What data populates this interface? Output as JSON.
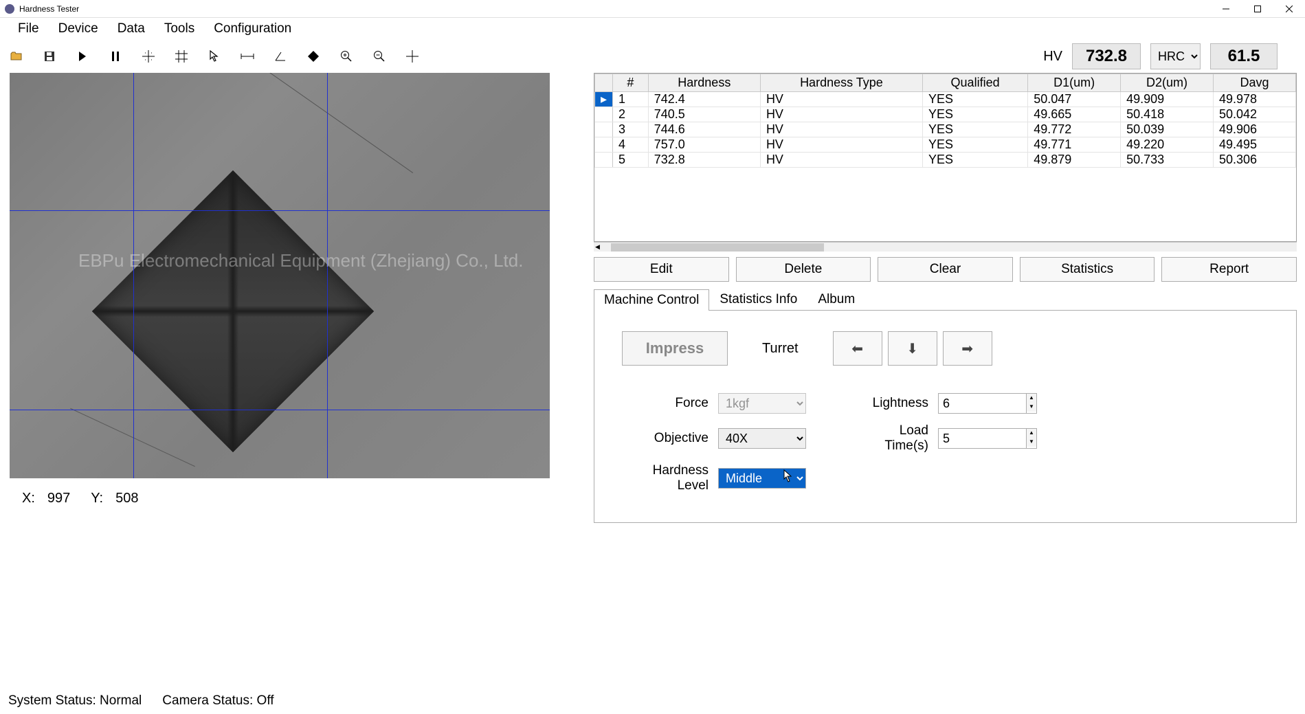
{
  "title": "Hardness Tester",
  "menu": [
    "File",
    "Device",
    "Data",
    "Tools",
    "Configuration"
  ],
  "readout": {
    "hv_label": "HV",
    "hv_value": "732.8",
    "scale_selected": "HRC",
    "scale_value": "61.5"
  },
  "watermark": "EBPu Electromechanical Equipment (Zhejiang) Co., Ltd.",
  "coords": {
    "x_label": "X:",
    "x": "997",
    "y_label": "Y:",
    "y": "508"
  },
  "columns": [
    "#",
    "Hardness",
    "Hardness Type",
    "Qualified",
    "D1(um)",
    "D2(um)",
    "Davg"
  ],
  "rows": [
    {
      "n": "1",
      "hardness": "742.4",
      "type": "HV",
      "qualified": "YES",
      "d1": "50.047",
      "d2": "49.909",
      "davg": "49.978"
    },
    {
      "n": "2",
      "hardness": "740.5",
      "type": "HV",
      "qualified": "YES",
      "d1": "49.665",
      "d2": "50.418",
      "davg": "50.042"
    },
    {
      "n": "3",
      "hardness": "744.6",
      "type": "HV",
      "qualified": "YES",
      "d1": "49.772",
      "d2": "50.039",
      "davg": "49.906"
    },
    {
      "n": "4",
      "hardness": "757.0",
      "type": "HV",
      "qualified": "YES",
      "d1": "49.771",
      "d2": "49.220",
      "davg": "49.495"
    },
    {
      "n": "5",
      "hardness": "732.8",
      "type": "HV",
      "qualified": "YES",
      "d1": "49.879",
      "d2": "50.733",
      "davg": "50.306"
    }
  ],
  "actions": {
    "edit": "Edit",
    "delete": "Delete",
    "clear": "Clear",
    "statistics": "Statistics",
    "report": "Report"
  },
  "tabs": {
    "machine": "Machine Control",
    "stats": "Statistics Info",
    "album": "Album"
  },
  "machine": {
    "impress": "Impress",
    "turret": "Turret",
    "force_label": "Force",
    "force_value": "1kgf",
    "objective_label": "Objective",
    "objective_value": "40X",
    "hardness_level_label": "Hardness Level",
    "hardness_level_value": "Middle",
    "lightness_label": "Lightness",
    "lightness_value": "6",
    "loadtime_label": "Load Time(s)",
    "loadtime_value": "5"
  },
  "status": {
    "system": "System Status: Normal",
    "camera": "Camera Status: Off"
  }
}
